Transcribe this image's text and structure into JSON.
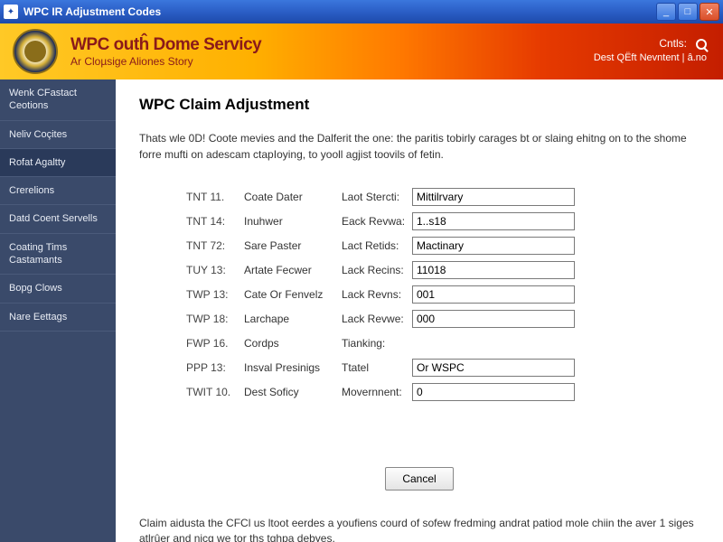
{
  "window": {
    "title": "WPC IR Adjustment Codes"
  },
  "header": {
    "title": "WPC outĥ Dome Servicy",
    "subtitle": "Ar Cloµsige Aliones Story",
    "right_line1": "Cntls:",
    "right_line2": "Dest QËft Nevntent  |  â.no"
  },
  "sidebar": {
    "items": [
      "Wenk CFastact Ceotions",
      "Neliv Coçites",
      "Rofat Agaltty",
      "Crerelions",
      "Datd Coent Servells",
      "Coating Tims Castamants",
      "Bopg Clows",
      "Nare Eettags"
    ]
  },
  "page": {
    "title": "WPC Claim Adjustment",
    "intro": "Thats wle 0D! Coote mevies and the Dalferit the one: the paritis tobirly carages bt or slaing ehitng on to the shome forre mufti on adescam ctapIoying, to yooll agjist toovils of fetin.",
    "rows": [
      {
        "code": "TNT 11.",
        "desc": "Coate Dater",
        "label": "Laot Stercti:",
        "value": "Mittilrvary"
      },
      {
        "code": "TNT 14:",
        "desc": "Inuhwer",
        "label": "Eack Revwa:",
        "value": "1..s18"
      },
      {
        "code": "TNT 72:",
        "desc": "Sare Paster",
        "label": "Lact Retids:",
        "value": "Mactinary"
      },
      {
        "code": "TUY 13:",
        "desc": "Artate Fecwer",
        "label": "Lack Recins:",
        "value": "11018"
      },
      {
        "code": "TWP 13:",
        "desc": "Cate Or Fenvelz",
        "label": "Lack Revns:",
        "value": "001"
      },
      {
        "code": "TWP 18:",
        "desc": "Larchape",
        "label": "Lack Revwe:",
        "value": "000"
      },
      {
        "code": "FWP 16.",
        "desc": "Cordps",
        "label": "Tianking:",
        "value": ""
      },
      {
        "code": "PPP 13:",
        "desc": "Insval Presinigs",
        "label": "Ttatel",
        "value": "Or WSPC",
        "offset": true
      },
      {
        "code": "TWIT 10.",
        "desc": "Dest Soficy",
        "label": "Movernnent:",
        "value": "0"
      }
    ],
    "cancel": "Cancel",
    "footer": "Claim aidusta the CFCl us ltoot eerdes a youfiens courd of sofew fredming andrat patiod mole chiin the aver 1 siges atlrûer and nicg we tor ths tghpa debyes."
  }
}
